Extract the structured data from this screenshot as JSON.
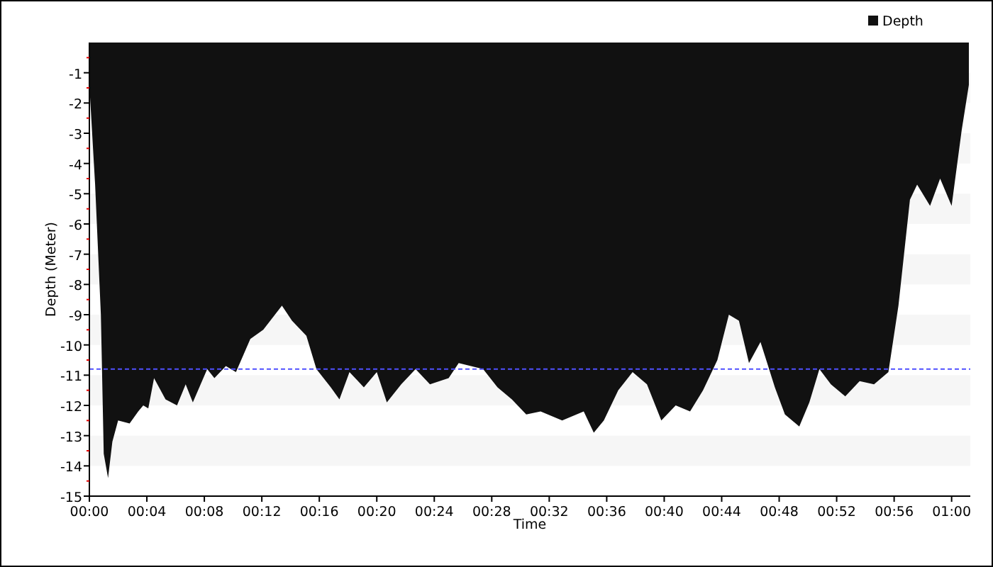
{
  "chart": {
    "chart_data": {
      "type": "area",
      "xlabel": "Time",
      "ylabel": "Depth (Meter)",
      "xlim": [
        0,
        61.3
      ],
      "ylim": [
        -15,
        0
      ],
      "xticks": [
        {
          "value": 0,
          "label": "00:00"
        },
        {
          "value": 4,
          "label": "00:04"
        },
        {
          "value": 8,
          "label": "00:08"
        },
        {
          "value": 12,
          "label": "00:12"
        },
        {
          "value": 16,
          "label": "00:16"
        },
        {
          "value": 20,
          "label": "00:20"
        },
        {
          "value": 24,
          "label": "00:24"
        },
        {
          "value": 28,
          "label": "00:28"
        },
        {
          "value": 32,
          "label": "00:32"
        },
        {
          "value": 36,
          "label": "00:36"
        },
        {
          "value": 40,
          "label": "00:40"
        },
        {
          "value": 44,
          "label": "00:44"
        },
        {
          "value": 48,
          "label": "00:48"
        },
        {
          "value": 52,
          "label": "00:52"
        },
        {
          "value": 56,
          "label": "00:56"
        },
        {
          "value": 60,
          "label": "01:00"
        }
      ],
      "yticks": [
        -1,
        -2,
        -3,
        -4,
        -5,
        -6,
        -7,
        -8,
        -9,
        -10,
        -11,
        -12,
        -13,
        -14,
        -15
      ],
      "x": [
        0,
        0.4,
        0.8,
        1.0,
        1.3,
        1.6,
        2.0,
        2.8,
        3.4,
        3.75,
        4.1,
        4.5,
        5.3,
        6.1,
        6.7,
        7.2,
        8.2,
        8.7,
        9.5,
        10.2,
        11.2,
        12.1,
        13.4,
        14.1,
        15.1,
        15.8,
        16.8,
        17.4,
        18.1,
        19.1,
        20.0,
        20.7,
        21.7,
        22.7,
        23.7,
        25.0,
        25.7,
        27.4,
        28.4,
        29.4,
        30.4,
        31.4,
        32.9,
        34.4,
        35.1,
        35.8,
        36.8,
        37.8,
        38.8,
        39.8,
        40.8,
        41.8,
        42.7,
        43.7,
        44.5,
        45.2,
        45.9,
        46.7,
        47.7,
        48.4,
        49.4,
        50.1,
        50.8,
        51.6,
        52.6,
        53.6,
        54.6,
        55.6,
        56.3,
        57.1,
        57.6,
        58.5,
        59.2,
        60.0,
        60.7,
        61.2
      ],
      "series": [
        {
          "name": "Depth",
          "color": "#111111",
          "values": [
            -1.4,
            -4.7,
            -9,
            -13.6,
            -14.4,
            -13.2,
            -12.5,
            -12.6,
            -12.2,
            -12.0,
            -12.1,
            -11.1,
            -11.8,
            -12.0,
            -11.3,
            -11.9,
            -10.8,
            -11.1,
            -10.7,
            -10.9,
            -9.8,
            -9.5,
            -8.7,
            -9.2,
            -9.7,
            -10.8,
            -11.4,
            -11.8,
            -10.9,
            -11.4,
            -10.9,
            -11.9,
            -11.3,
            -10.8,
            -11.3,
            -11.1,
            -10.6,
            -10.8,
            -11.4,
            -11.8,
            -12.3,
            -12.2,
            -12.5,
            -12.2,
            -12.9,
            -12.5,
            -11.5,
            -10.9,
            -11.3,
            -12.5,
            -12.0,
            -12.2,
            -11.5,
            -10.5,
            -9.0,
            -9.2,
            -10.6,
            -9.9,
            -11.4,
            -12.3,
            -12.7,
            -11.9,
            -10.8,
            -11.3,
            -11.7,
            -11.2,
            -11.3,
            -10.9,
            -8.7,
            -5.2,
            -4.7,
            -5.4,
            -4.5,
            -5.4,
            -2.9,
            -1.4
          ]
        }
      ],
      "ref_lines": [
        {
          "axis": "y",
          "value": -10.8,
          "color": "#5050ff"
        }
      ]
    }
  }
}
